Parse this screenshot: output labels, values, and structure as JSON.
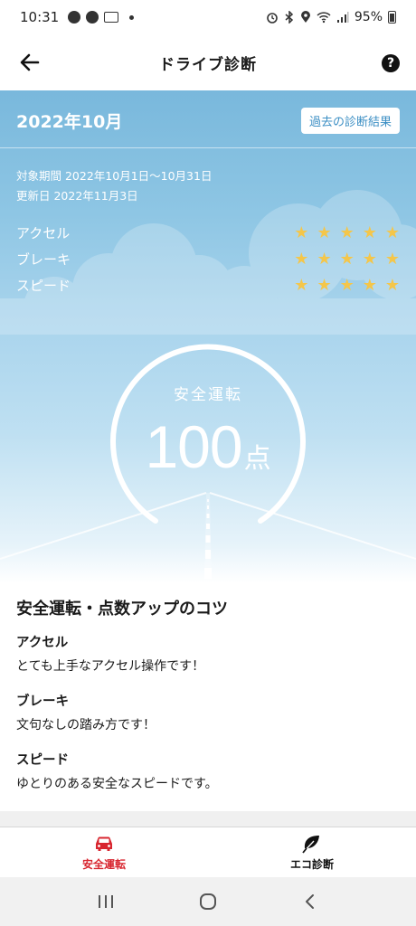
{
  "status_bar": {
    "time": "10:31",
    "battery": "95%"
  },
  "header": {
    "title": "ドライブ診断"
  },
  "hero": {
    "month": "2022年10月",
    "history_button": "過去の診断結果",
    "period": "対象期間 2022年10月1日〜10月31日",
    "updated": "更新日 2022年11月3日",
    "ratings": [
      {
        "label": "アクセル",
        "stars": 5
      },
      {
        "label": "ブレーキ",
        "stars": 5
      },
      {
        "label": "スピード",
        "stars": 5
      }
    ],
    "gauge_label": "安全運転",
    "score": "100",
    "score_unit": "点",
    "colors": {
      "sky": "#79b8dc",
      "star": "#f4c64a"
    }
  },
  "tips": {
    "title": "安全運転・点数アップのコツ",
    "items": [
      {
        "heading": "アクセル",
        "text": "とても上手なアクセル操作です！"
      },
      {
        "heading": "ブレーキ",
        "text": "文句なしの踏み方です！"
      },
      {
        "heading": "スピード",
        "text": "ゆとりのある安全なスピードです。"
      }
    ]
  },
  "tabs": [
    {
      "label": "安全運転",
      "icon": "car-icon",
      "active": true,
      "color": "#d8262f"
    },
    {
      "label": "エコ診断",
      "icon": "leaf-icon",
      "active": false
    }
  ],
  "nav": {
    "icons": [
      "recents-icon",
      "home-icon",
      "back-icon"
    ]
  }
}
